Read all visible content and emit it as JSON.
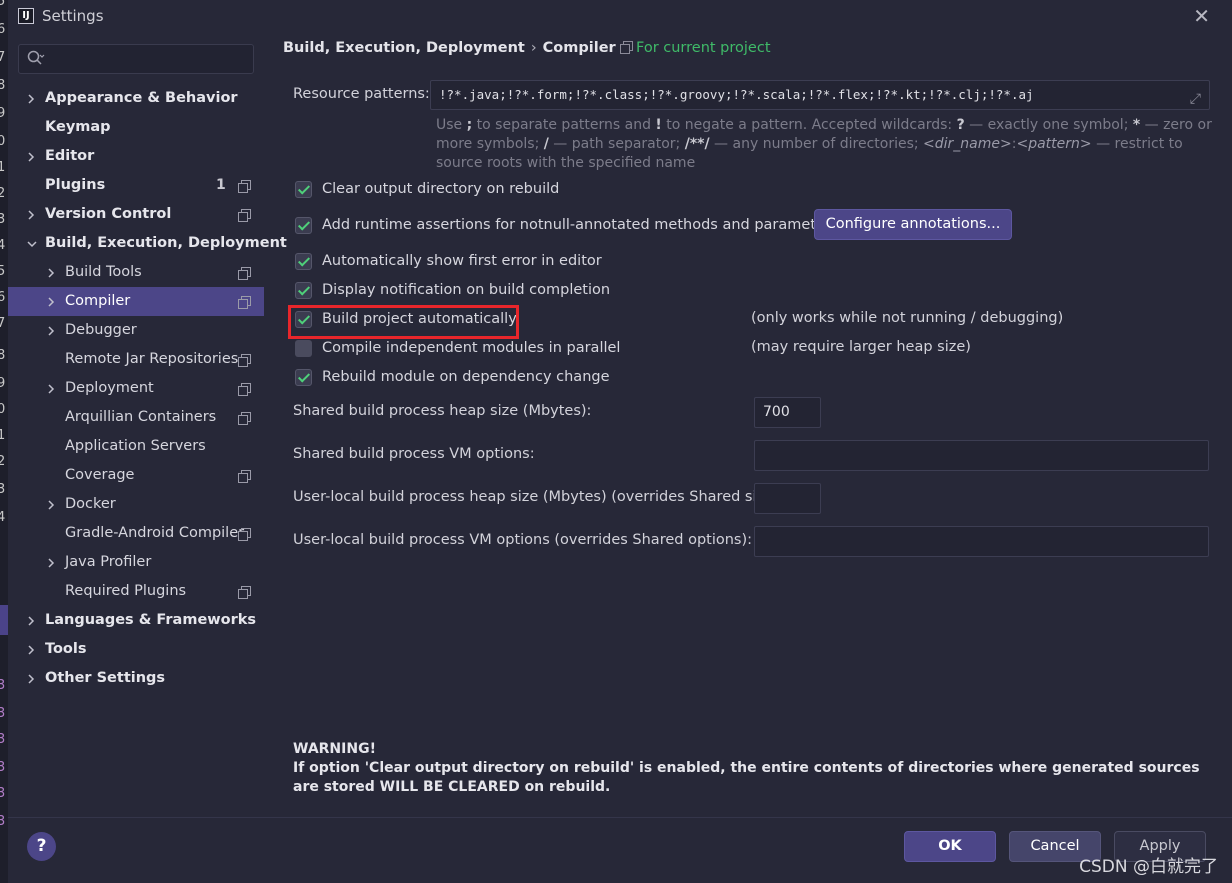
{
  "window": {
    "title": "Settings",
    "app_icon": "IJ"
  },
  "sidebar": {
    "search_placeholder": "",
    "items": [
      {
        "label": "Appearance & Behavior",
        "level": 0,
        "bold": true,
        "expandable": true,
        "expanded": false
      },
      {
        "label": "Keymap",
        "level": 0,
        "bold": true,
        "expandable": false
      },
      {
        "label": "Editor",
        "level": 0,
        "bold": true,
        "expandable": true,
        "expanded": false
      },
      {
        "label": "Plugins",
        "level": 0,
        "bold": true,
        "expandable": false,
        "badge": "1",
        "project_icon": true
      },
      {
        "label": "Version Control",
        "level": 0,
        "bold": true,
        "expandable": true,
        "expanded": false,
        "project_icon": true
      },
      {
        "label": "Build, Execution, Deployment",
        "level": 0,
        "bold": true,
        "expandable": true,
        "expanded": true
      },
      {
        "label": "Build Tools",
        "level": 1,
        "expandable": true,
        "expanded": false,
        "project_icon": true
      },
      {
        "label": "Compiler",
        "level": 1,
        "expandable": true,
        "expanded": false,
        "project_icon": true,
        "selected": true
      },
      {
        "label": "Debugger",
        "level": 1,
        "expandable": true,
        "expanded": false
      },
      {
        "label": "Remote Jar Repositories",
        "level": 1,
        "expandable": false,
        "project_icon": true
      },
      {
        "label": "Deployment",
        "level": 1,
        "expandable": true,
        "expanded": false,
        "project_icon": true
      },
      {
        "label": "Arquillian Containers",
        "level": 1,
        "expandable": false,
        "project_icon": true
      },
      {
        "label": "Application Servers",
        "level": 1,
        "expandable": false
      },
      {
        "label": "Coverage",
        "level": 1,
        "expandable": false,
        "project_icon": true
      },
      {
        "label": "Docker",
        "level": 1,
        "expandable": true,
        "expanded": false
      },
      {
        "label": "Gradle-Android Compiler",
        "level": 1,
        "expandable": false,
        "project_icon": true
      },
      {
        "label": "Java Profiler",
        "level": 1,
        "expandable": true,
        "expanded": false
      },
      {
        "label": "Required Plugins",
        "level": 1,
        "expandable": false,
        "project_icon": true
      },
      {
        "label": "Languages & Frameworks",
        "level": 0,
        "bold": true,
        "expandable": true,
        "expanded": false
      },
      {
        "label": "Tools",
        "level": 0,
        "bold": true,
        "expandable": true,
        "expanded": false
      },
      {
        "label": "Other Settings",
        "level": 0,
        "bold": true,
        "expandable": true,
        "expanded": false
      }
    ]
  },
  "breadcrumb": {
    "parent": "Build, Execution, Deployment",
    "separator": "›",
    "current": "Compiler"
  },
  "scope_note": "For current project",
  "resource_patterns": {
    "label": "Resource patterns:",
    "value": "!?*.java;!?*.form;!?*.class;!?*.groovy;!?*.scala;!?*.flex;!?*.kt;!?*.clj;!?*.aj"
  },
  "hint": {
    "p1": "Use ",
    "b1": ";",
    "p2": " to separate patterns and ",
    "b2": "!",
    "p3": " to negate a pattern. Accepted wildcards: ",
    "b3": "?",
    "p4": " — exactly one symbol; ",
    "b4": "*",
    "p5": " — zero or more symbols; ",
    "b5": "/",
    "p6": " — path separator; ",
    "b6": "/**/",
    "p7": " — any number of directories; ",
    "i1": "<dir_name>",
    "p8": ":",
    "i2": "<pattern>",
    "p9": " — restrict to source roots with the specified name"
  },
  "checkboxes": [
    {
      "label": "Clear output directory on rebuild",
      "checked": true
    },
    {
      "label": "Add runtime assertions for notnull-annotated methods and parameters",
      "checked": true
    },
    {
      "label": "Automatically show first error in editor",
      "checked": true
    },
    {
      "label": "Display notification on build completion",
      "checked": true
    },
    {
      "label": "Build project automatically",
      "checked": true,
      "note": "(only works while not running / debugging)"
    },
    {
      "label": "Compile independent modules in parallel",
      "checked": false,
      "note": "(may require larger heap size)"
    },
    {
      "label": "Rebuild module on dependency change",
      "checked": true
    }
  ],
  "configure_annotations_label": "Configure annotations...",
  "fields": [
    {
      "label": "Shared build process heap size (Mbytes):",
      "value": "700"
    },
    {
      "label": "Shared build process VM options:",
      "value": ""
    },
    {
      "label": "User-local build process heap size (Mbytes) (overrides Shared size):",
      "value": ""
    },
    {
      "label": "User-local build process VM options (overrides Shared options):",
      "value": ""
    }
  ],
  "warning": {
    "title": "WARNING!",
    "body": "If option 'Clear output directory on rebuild' is enabled, the entire contents of directories where generated sources are stored WILL BE CLEARED on rebuild."
  },
  "footer": {
    "help": "?",
    "ok": "OK",
    "cancel": "Cancel",
    "apply": "Apply",
    "watermark": "CSDN @白就完了"
  },
  "icons": {
    "search": "search-icon",
    "close": "close-icon",
    "chevron_right": "chevron-right-icon",
    "chevron_down": "chevron-down-icon",
    "project": "project-scope-icon",
    "expand": "expand-icon"
  },
  "colors": {
    "accent": "#4c4688",
    "scope_green": "#3fba68",
    "highlight_red": "#e8262b",
    "checkmark": "#4fd07a"
  }
}
